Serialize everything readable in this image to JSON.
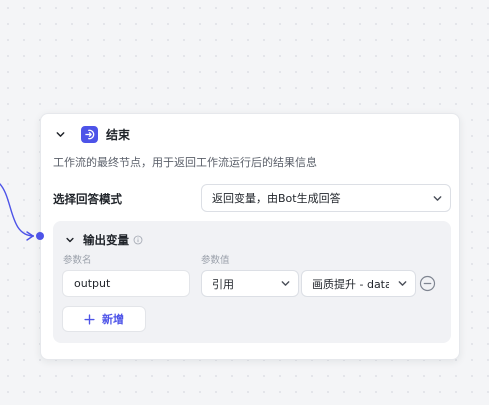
{
  "colors": {
    "accent": "#4d53e8",
    "canvas": "#f4f5f7",
    "panel": "#f1f2f5"
  },
  "node": {
    "icon": "end-icon",
    "title": "结束",
    "description": "工作流的最终节点，用于返回工作流运行后的结果信息",
    "answer_mode": {
      "label": "选择回答模式",
      "selected": "返回变量，由Bot生成回答"
    },
    "output": {
      "title": "输出变量",
      "col_name": "参数名",
      "col_value": "参数值",
      "row": {
        "name": "output",
        "type": "引用",
        "value": "画质提升 - data"
      },
      "add_label": "新增"
    }
  }
}
